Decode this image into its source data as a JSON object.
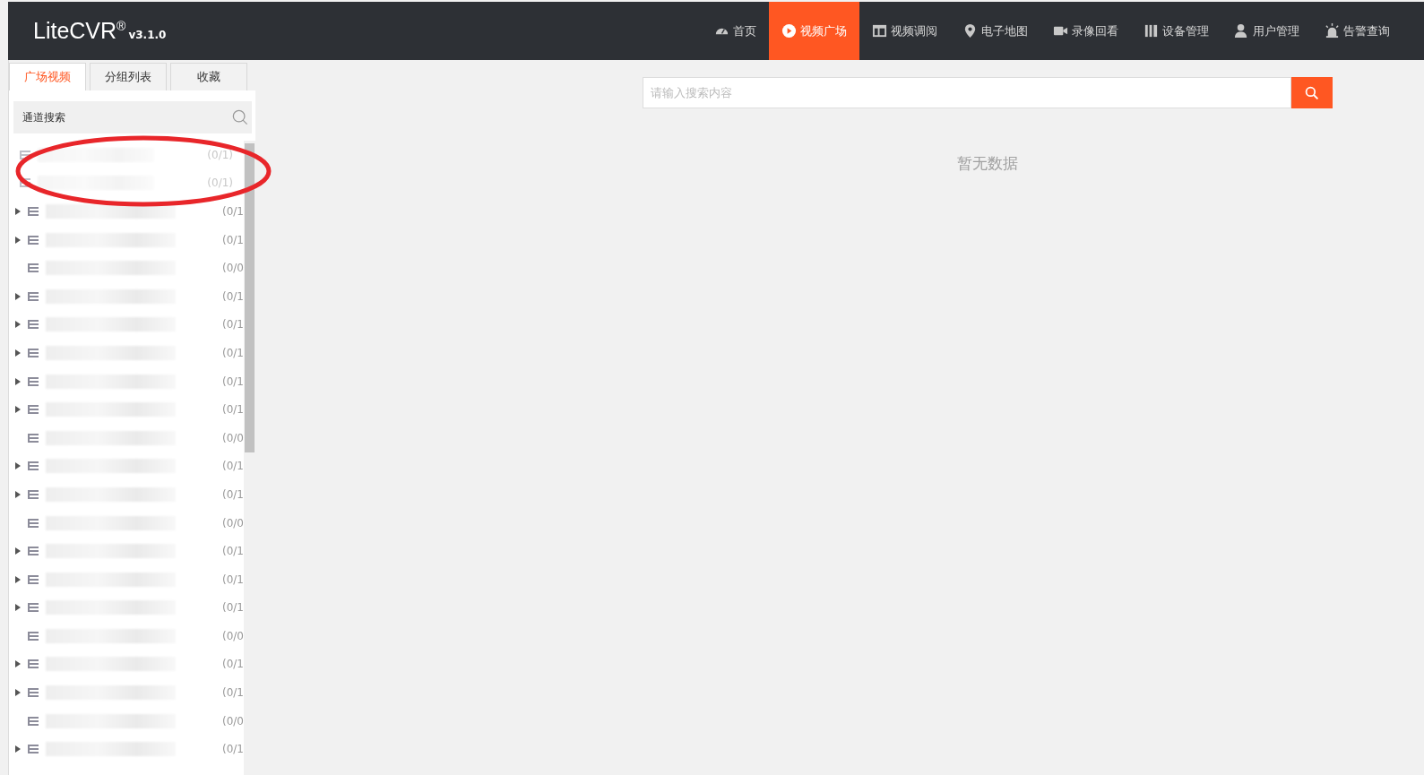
{
  "header": {
    "logo": "LiteCVR",
    "logo_mark": "®",
    "version": "v3.1.0",
    "nav": [
      {
        "label": "首页",
        "selected": false
      },
      {
        "label": "视频广场",
        "selected": true
      },
      {
        "label": "视频调阅",
        "selected": false
      },
      {
        "label": "电子地图",
        "selected": false
      },
      {
        "label": "录像回看",
        "selected": false
      },
      {
        "label": "设备管理",
        "selected": false
      },
      {
        "label": "用户管理",
        "selected": false
      },
      {
        "label": "告警查询",
        "selected": false
      }
    ]
  },
  "sidebar": {
    "tabs": [
      {
        "label": "广场视频",
        "selected": true
      },
      {
        "label": "分组列表",
        "selected": false
      },
      {
        "label": "收藏",
        "selected": false
      }
    ],
    "search": {
      "placeholder": "通道搜索"
    },
    "tree": [
      {
        "kind": "root",
        "count": "(0/1)"
      },
      {
        "kind": "root",
        "count": "(0/1)"
      },
      {
        "kind": "node",
        "expandable": true,
        "count": "(0/1"
      },
      {
        "kind": "node",
        "expandable": true,
        "count": "(0/1"
      },
      {
        "kind": "node",
        "expandable": false,
        "count": "(0/0"
      },
      {
        "kind": "node",
        "expandable": true,
        "count": "(0/1"
      },
      {
        "kind": "node",
        "expandable": true,
        "count": "(0/1"
      },
      {
        "kind": "node",
        "expandable": true,
        "count": "(0/1"
      },
      {
        "kind": "node",
        "expandable": true,
        "count": "(0/1"
      },
      {
        "kind": "node",
        "expandable": true,
        "count": "(0/1"
      },
      {
        "kind": "node",
        "expandable": false,
        "count": "(0/0"
      },
      {
        "kind": "node",
        "expandable": true,
        "count": "(0/1"
      },
      {
        "kind": "node",
        "expandable": true,
        "count": "(0/1"
      },
      {
        "kind": "node",
        "expandable": false,
        "count": "(0/0"
      },
      {
        "kind": "node",
        "expandable": true,
        "count": "(0/1"
      },
      {
        "kind": "node",
        "expandable": true,
        "count": "(0/1"
      },
      {
        "kind": "node",
        "expandable": true,
        "count": "(0/1"
      },
      {
        "kind": "node",
        "expandable": false,
        "count": "(0/0"
      },
      {
        "kind": "node",
        "expandable": true,
        "count": "(0/1"
      },
      {
        "kind": "node",
        "expandable": true,
        "count": "(0/1"
      },
      {
        "kind": "node",
        "expandable": false,
        "count": "(0/0"
      },
      {
        "kind": "node",
        "expandable": true,
        "count": "(0/1"
      }
    ],
    "annotation": {
      "kind": "ellipse",
      "color": "#e8262a"
    }
  },
  "main": {
    "search": {
      "placeholder": "请输入搜索内容"
    },
    "empty_text": "暂无数据"
  }
}
